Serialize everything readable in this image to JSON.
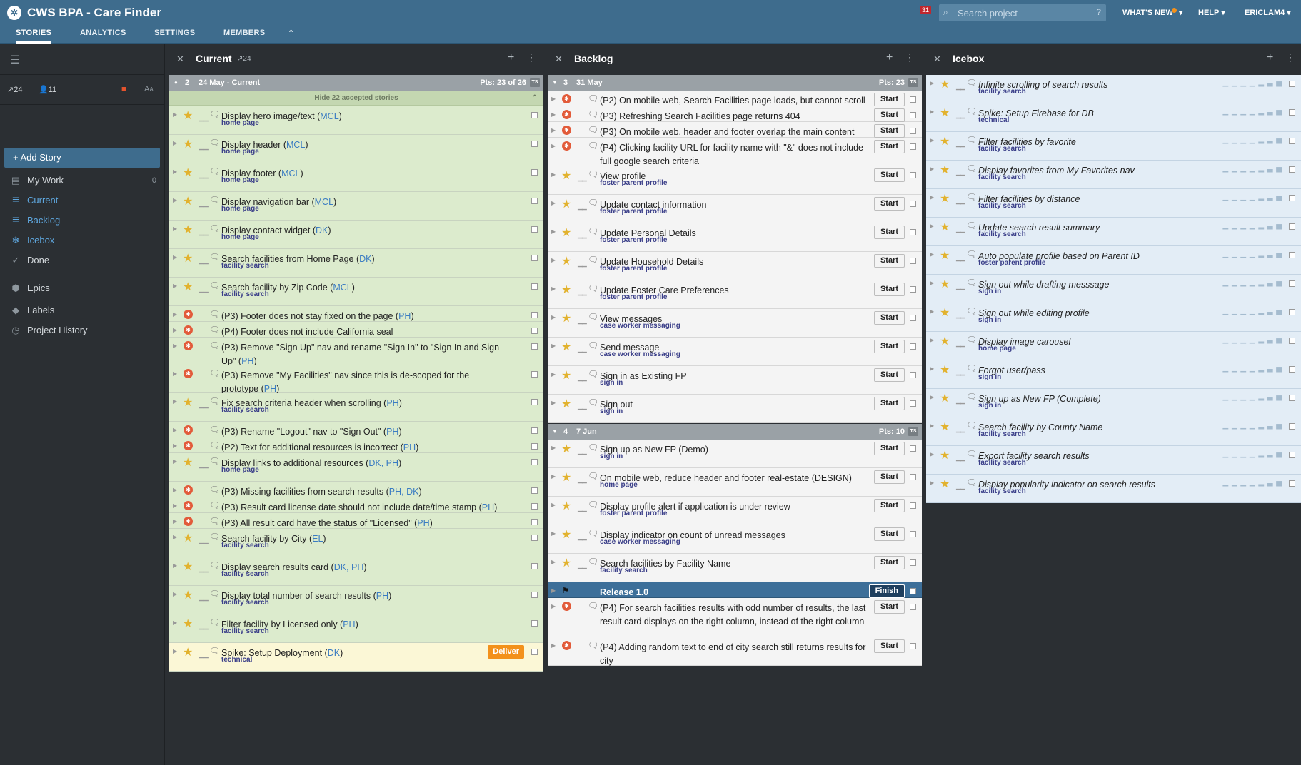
{
  "app": {
    "title": "CWS BPA - Care Finder",
    "notification_count": "31"
  },
  "search": {
    "placeholder": "Search project",
    "help": "?"
  },
  "topnav": {
    "whats_new": "WHAT'S NEW",
    "help": "HELP",
    "user": "ERICLAM4"
  },
  "tabs": [
    "STORIES",
    "ANALYTICS",
    "SETTINGS",
    "MEMBERS"
  ],
  "sidebar": {
    "velocity": "24",
    "members": "11",
    "add_story": "Add Story",
    "items": [
      {
        "label": "My Work",
        "count": "0",
        "icon": "my-work-icon"
      },
      {
        "label": "Current",
        "icon": "list-icon"
      },
      {
        "label": "Backlog",
        "icon": "list-icon"
      },
      {
        "label": "Icebox",
        "icon": "snowflake-icon"
      },
      {
        "label": "Done",
        "icon": "check-icon"
      },
      {
        "label": "Epics",
        "icon": "epics-icon"
      },
      {
        "label": "Labels",
        "icon": "tag-icon"
      },
      {
        "label": "Project History",
        "icon": "clock-icon"
      }
    ]
  },
  "current": {
    "title": "Current",
    "velocity": "24",
    "iteration": {
      "num": "2",
      "date": "24 May - Current",
      "pts": "Pts: 23 of 26",
      "ts": "TS"
    },
    "hide_accepted": "Hide 22 accepted stories",
    "stories": [
      {
        "type": "feature",
        "name": "Display hero image/text (",
        "owner": "MCL",
        "end": ")",
        "label": "home page"
      },
      {
        "type": "feature",
        "name": "Display header (",
        "owner": "MCL",
        "end": ")",
        "label": "home page"
      },
      {
        "type": "feature",
        "name": "Display footer (",
        "owner": "MCL",
        "end": ")",
        "label": "home page"
      },
      {
        "type": "feature",
        "name": "Display navigation bar (",
        "owner": "MCL",
        "end": ")",
        "label": "home page"
      },
      {
        "type": "feature",
        "name": "Display contact widget (",
        "owner": "DK",
        "end": ")",
        "label": "home page"
      },
      {
        "type": "feature",
        "name": "Search facilities from Home Page (",
        "owner": "DK",
        "end": ")",
        "label": "facility search"
      },
      {
        "type": "feature",
        "name": "Search facility by Zip Code (",
        "owner": "MCL",
        "end": ")",
        "label": "facility search"
      },
      {
        "type": "bug",
        "name": "(P3) Footer does not stay fixed on the page (",
        "owner": "PH",
        "end": ")",
        "label": ""
      },
      {
        "type": "bug",
        "name": "(P4) Footer does not include California seal",
        "owner": "",
        "end": "",
        "label": ""
      },
      {
        "type": "bug",
        "name": "(P3) Remove \"Sign Up\" nav and rename \"Sign In\" to \"Sign In and Sign Up\" (",
        "owner": "PH",
        "end": ")",
        "label": ""
      },
      {
        "type": "bug",
        "name": "(P3) Remove \"My Facilities\" nav since this is de-scoped for the prototype (",
        "owner": "PH",
        "end": ")",
        "label": ""
      },
      {
        "type": "feature",
        "name": "Fix search criteria header when scrolling (",
        "owner": "PH",
        "end": ")",
        "label": "facility search"
      },
      {
        "type": "bug",
        "name": "(P3) Rename \"Logout\" nav to \"Sign Out\" (",
        "owner": "PH",
        "end": ")",
        "label": ""
      },
      {
        "type": "bug",
        "name": "(P2) Text for additional resources is incorrect (",
        "owner": "PH",
        "end": ")",
        "label": ""
      },
      {
        "type": "feature",
        "name": "Display links to additional resources (",
        "owner": "DK, PH",
        "end": ")",
        "label": "home page"
      },
      {
        "type": "bug",
        "name": "(P3) Missing facilities from search results (",
        "owner": "PH, DK",
        "end": ")",
        "label": ""
      },
      {
        "type": "bug",
        "name": "(P3) Result card license date should not include date/time stamp (",
        "owner": "PH",
        "end": ")",
        "label": ""
      },
      {
        "type": "bug",
        "name": "(P3) All result card have the status of \"Licensed\" (",
        "owner": "PH",
        "end": ")",
        "label": ""
      },
      {
        "type": "feature",
        "name": "Search facility by City (",
        "owner": "EL",
        "end": ")",
        "label": "facility search"
      },
      {
        "type": "feature",
        "name": "Display search results card (",
        "owner": "DK, PH",
        "end": ")",
        "label": "facility search"
      },
      {
        "type": "feature",
        "name": "Display total number of search results (",
        "owner": "PH",
        "end": ")",
        "label": "facility search"
      },
      {
        "type": "feature",
        "name": "Filter facility by Licensed only (",
        "owner": "PH",
        "end": ")",
        "label": "facility search"
      },
      {
        "type": "feature",
        "name": "Spike: Setup Deployment (",
        "owner": "DK",
        "end": ")",
        "label": "technical",
        "button": "Deliver"
      }
    ]
  },
  "backlog": {
    "title": "Backlog",
    "iterations": [
      {
        "num": "3",
        "date": "31 May",
        "pts": "Pts: 23",
        "ts": "TS"
      },
      {
        "num": "4",
        "date": "7 Jun",
        "pts": "Pts: 10",
        "ts": "TS"
      }
    ],
    "stories1": [
      {
        "type": "bug",
        "name": "(P2) On mobile web, Search Facilities page loads, but cannot scroll",
        "label": "",
        "button": "Start"
      },
      {
        "type": "bug",
        "name": "(P3) Refreshing Search Facilities page returns 404",
        "label": "",
        "button": "Start"
      },
      {
        "type": "bug",
        "name": "(P3) On mobile web, header and footer overlap the main content",
        "label": "",
        "button": "Start"
      },
      {
        "type": "bug",
        "name": "(P4) Clicking facility URL for facility name with \"&\" does not include full google search criteria",
        "label": "",
        "button": "Start"
      },
      {
        "type": "feature",
        "name": "View profile",
        "label": "foster parent profile",
        "button": "Start"
      },
      {
        "type": "feature",
        "name": "Update contact information",
        "label": "foster parent profile",
        "button": "Start"
      },
      {
        "type": "feature",
        "name": "Update Personal Details",
        "label": "foster parent profile",
        "button": "Start"
      },
      {
        "type": "feature",
        "name": "Update Household Details",
        "label": "foster parent profile",
        "button": "Start"
      },
      {
        "type": "feature",
        "name": "Update Foster Care Preferences",
        "label": "foster parent profile",
        "button": "Start"
      },
      {
        "type": "feature",
        "name": "View messages",
        "label": "case worker messaging",
        "button": "Start"
      },
      {
        "type": "feature",
        "name": "Send message",
        "label": "case worker messaging",
        "button": "Start"
      },
      {
        "type": "feature",
        "name": "Sign in as Existing FP",
        "label": "sign in",
        "button": "Start"
      },
      {
        "type": "feature",
        "name": "Sign out",
        "label": "sign in",
        "button": "Start"
      }
    ],
    "stories2": [
      {
        "type": "feature",
        "name": "Sign up as New FP (Demo)",
        "label": "sign in",
        "button": "Start"
      },
      {
        "type": "feature",
        "name": "On mobile web, reduce header and footer real-estate (DESIGN)",
        "label": "home page",
        "button": "Start"
      },
      {
        "type": "feature",
        "name": "Display profile alert if application is under review",
        "label": "foster parent profile",
        "button": "Start"
      },
      {
        "type": "feature",
        "name": "Display indicator on count of unread messages",
        "label": "case worker messaging",
        "button": "Start"
      },
      {
        "type": "feature",
        "name": "Search facilities by Facility Name",
        "label": "facility search",
        "button": "Start"
      },
      {
        "type": "release",
        "name": "Release 1.0",
        "label": "",
        "button": "Finish"
      },
      {
        "type": "bug",
        "name": "(P4) For search facilities results with odd number of results, the last result card displays on the right column, instead of the right column",
        "label": "",
        "button": "Start"
      },
      {
        "type": "bug",
        "name": "(P4) Adding random text to end of city search still returns results for city",
        "label": "",
        "button": "Start"
      }
    ]
  },
  "icebox": {
    "title": "Icebox",
    "stories": [
      {
        "name": "Infinite scrolling of search results",
        "label": "facility search"
      },
      {
        "name": "Spike: Setup Firebase for DB",
        "label": "technical"
      },
      {
        "name": "Filter facilities by favorite",
        "label": "facility search"
      },
      {
        "name": "Display favorites from My Favorites nav",
        "label": "facility search"
      },
      {
        "name": "Filter facilities by distance",
        "label": "facility search"
      },
      {
        "name": "Update search result summary",
        "label": "facility search"
      },
      {
        "name": "Auto populate profile based on Parent ID",
        "label": "foster parent profile"
      },
      {
        "name": "Sign out while drafting messsage",
        "label": "sign in"
      },
      {
        "name": "Sign out while editing profile",
        "label": "sign in"
      },
      {
        "name": "Display image carousel",
        "label": "home page"
      },
      {
        "name": "Forgot user/pass",
        "label": "sign in"
      },
      {
        "name": "Sign up as New FP (Complete)",
        "label": "sign in"
      },
      {
        "name": "Search facility by County Name",
        "label": "facility search"
      },
      {
        "name": "Export facility search results",
        "label": "facility search"
      },
      {
        "name": "Display popularity indicator on search results",
        "label": "facility search"
      }
    ]
  },
  "colors": {
    "header": "#3e6c8d",
    "accepted": "#dcebcd",
    "icebox": "#e3edf6",
    "deliver": "#f3911b",
    "release": "#3d6f99"
  }
}
